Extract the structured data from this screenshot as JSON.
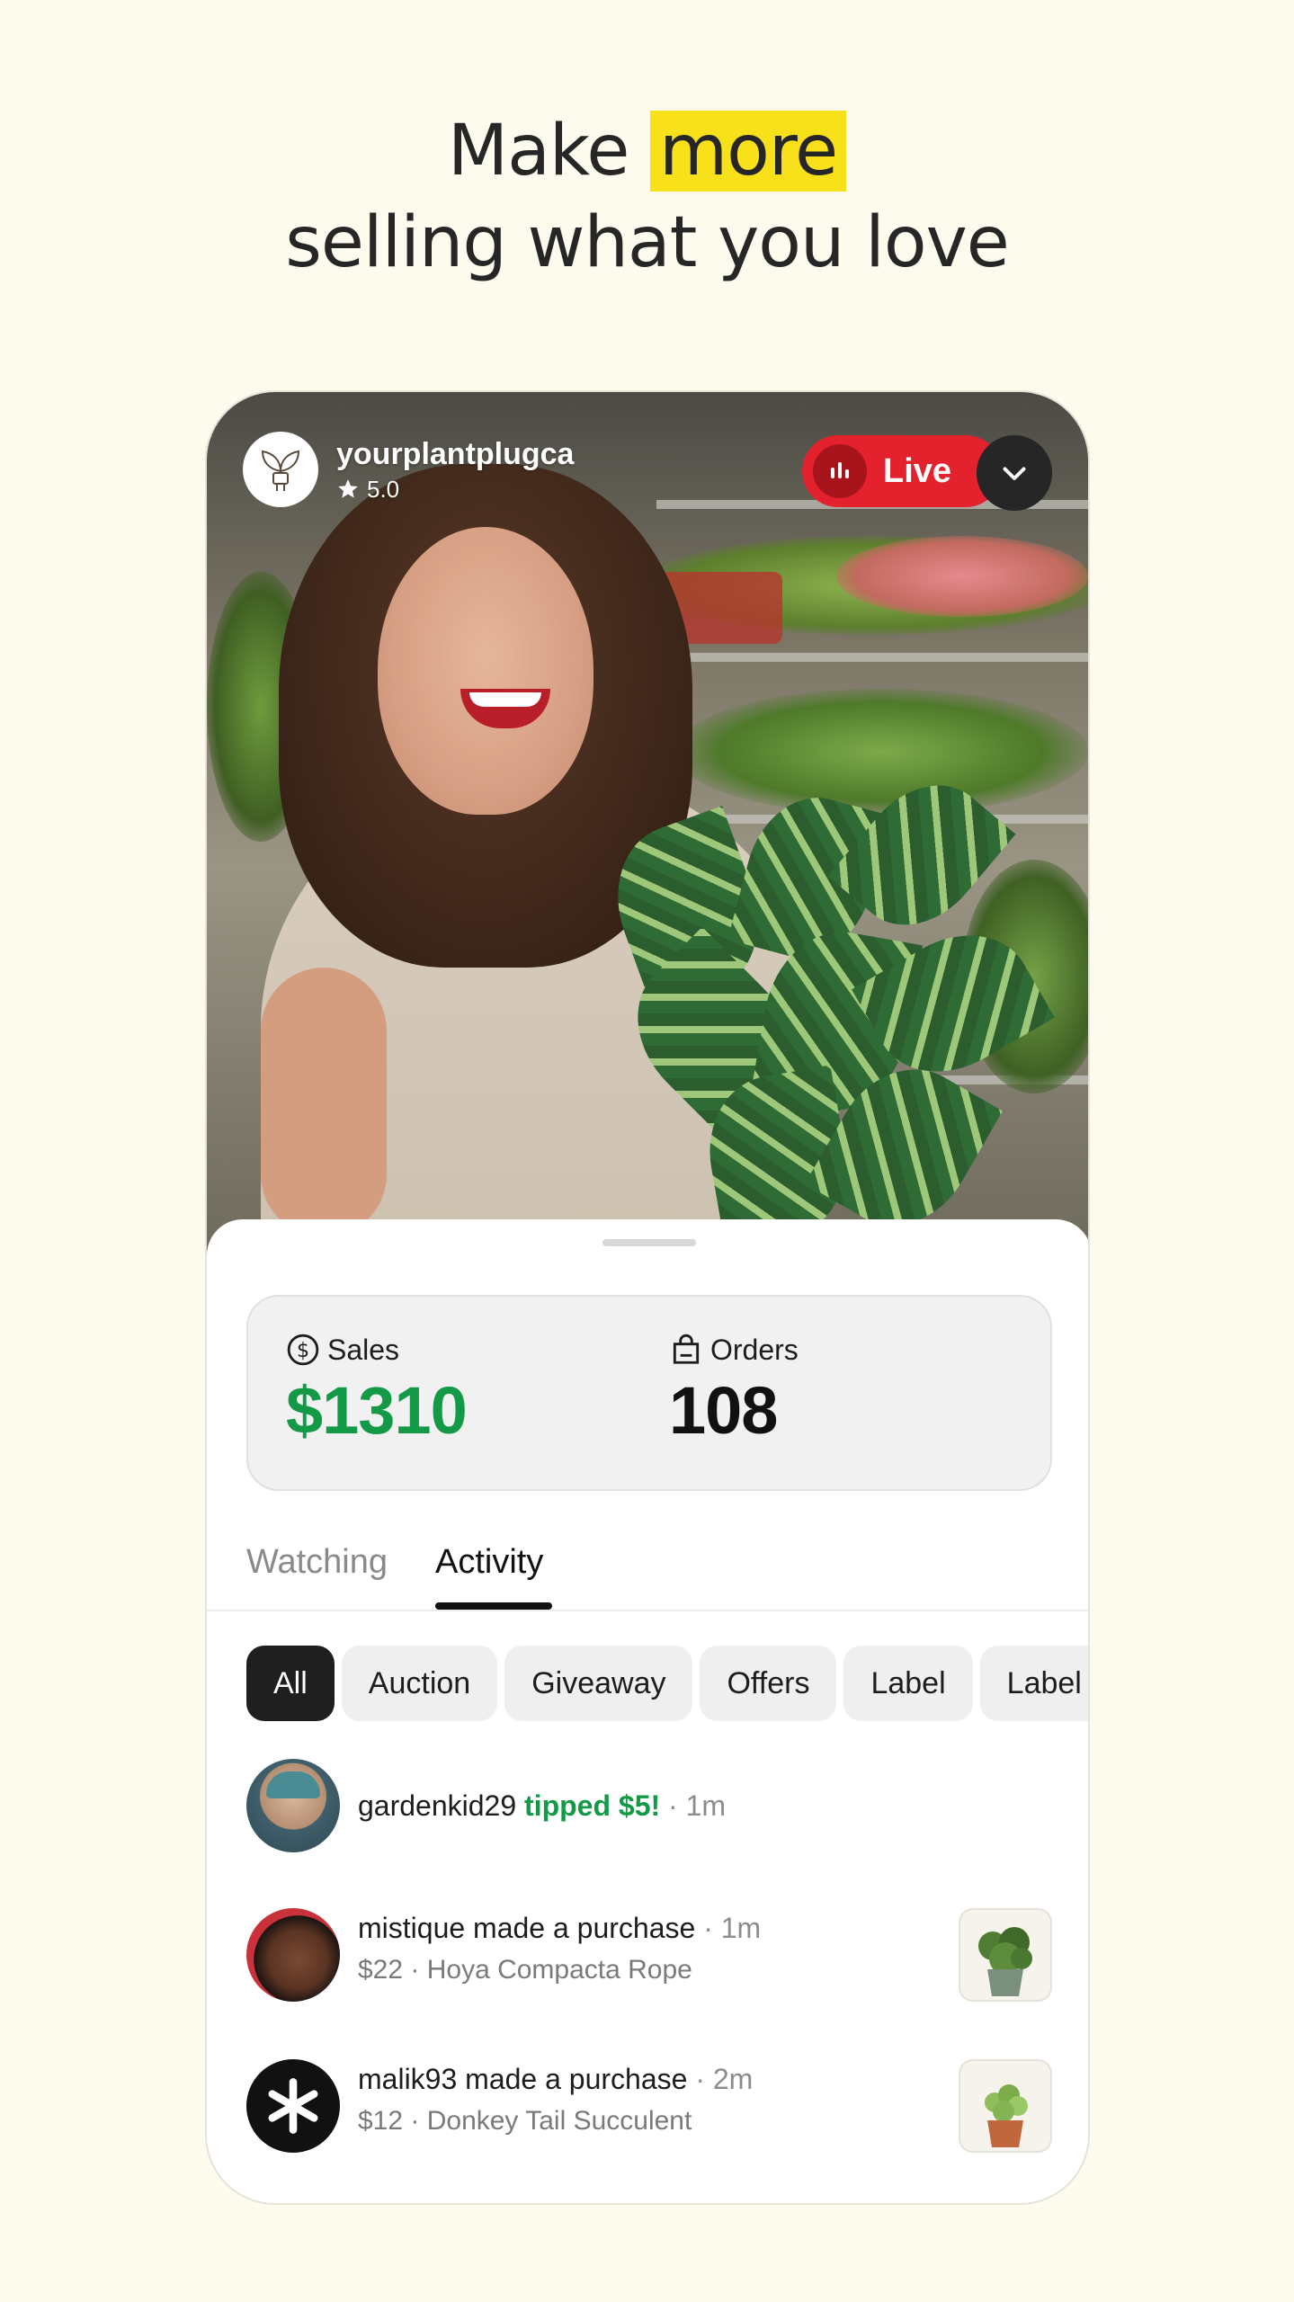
{
  "headline": {
    "line1_prefix": "Make",
    "line1_highlight": "more",
    "line2": "selling what you love"
  },
  "stream": {
    "seller_name": "yourplantplugca",
    "seller_rating": "5.0",
    "live_label": "Live",
    "seller_avatar_icon": "plant-plug-icon",
    "collapse_icon": "chevron-down-icon"
  },
  "stats": {
    "sales_label": "Sales",
    "sales_value": "$1310",
    "orders_label": "Orders",
    "orders_value": "108",
    "sales_color": "#149a47"
  },
  "tabs": [
    {
      "label": "Watching",
      "active": false
    },
    {
      "label": "Activity",
      "active": true
    }
  ],
  "filters": [
    {
      "label": "All",
      "active": true
    },
    {
      "label": "Auction"
    },
    {
      "label": "Giveaway"
    },
    {
      "label": "Offers"
    },
    {
      "label": "Label"
    },
    {
      "label": "Label"
    }
  ],
  "activity": [
    {
      "user": "gardenkid29",
      "action": "tipped $5!",
      "time": "1m"
    },
    {
      "user": "mistique",
      "action": "made a purchase",
      "time": "1m",
      "detail": "$22 · Hoya Compacta Rope"
    },
    {
      "user": "malik93",
      "action": "made a purchase",
      "time": "2m",
      "detail": "$12 · Donkey Tail Succulent"
    }
  ],
  "colors": {
    "background": "#fdfbee",
    "highlight": "#f8e01a",
    "live": "#e3222d",
    "accent_green": "#149a47"
  }
}
